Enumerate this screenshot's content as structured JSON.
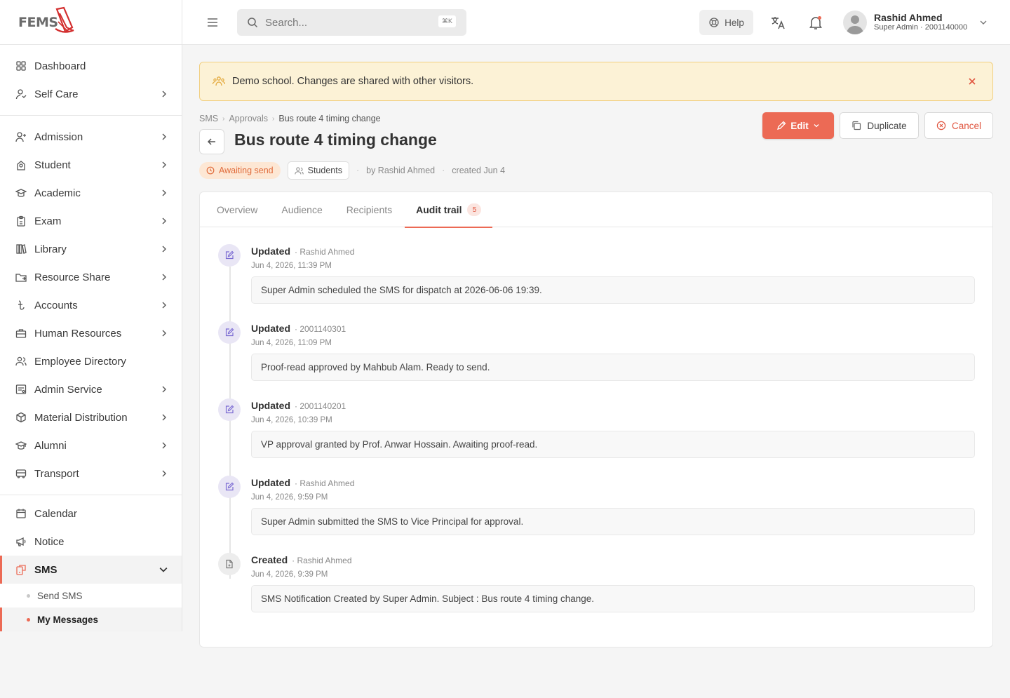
{
  "brand": {
    "logo_text": "FEMS"
  },
  "sidebar": {
    "group1": [
      {
        "label": "Dashboard",
        "icon": "grid-icon",
        "chevron": false
      },
      {
        "label": "Self Care",
        "icon": "user-care-icon",
        "chevron": true
      }
    ],
    "group2": [
      {
        "label": "Admission",
        "icon": "user-plus-icon",
        "chevron": true
      },
      {
        "label": "Student",
        "icon": "student-icon",
        "chevron": true
      },
      {
        "label": "Academic",
        "icon": "graduation-cap-icon",
        "chevron": true
      },
      {
        "label": "Exam",
        "icon": "clipboard-icon",
        "chevron": true
      },
      {
        "label": "Library",
        "icon": "books-icon",
        "chevron": true
      },
      {
        "label": "Resource Share",
        "icon": "folder-share-icon",
        "chevron": true
      },
      {
        "label": "Accounts",
        "icon": "taka-icon",
        "chevron": true
      },
      {
        "label": "Human Resources",
        "icon": "briefcase-icon",
        "chevron": true
      },
      {
        "label": "Employee Directory",
        "icon": "users-icon",
        "chevron": false
      },
      {
        "label": "Admin Service",
        "icon": "admin-service-icon",
        "chevron": true
      },
      {
        "label": "Material Distribution",
        "icon": "box-icon",
        "chevron": true
      },
      {
        "label": "Alumni",
        "icon": "alumni-cap-icon",
        "chevron": true
      },
      {
        "label": "Transport",
        "icon": "bus-icon",
        "chevron": true
      }
    ],
    "group3": [
      {
        "label": "Calendar",
        "icon": "calendar-icon"
      },
      {
        "label": "Notice",
        "icon": "megaphone-icon"
      },
      {
        "label": "SMS",
        "icon": "sms-icon"
      }
    ],
    "sms_sub": [
      {
        "label": "Send SMS"
      },
      {
        "label": "My Messages"
      }
    ]
  },
  "topbar": {
    "search_placeholder": "Search...",
    "search_shortcut": "⌘K",
    "help_label": "Help",
    "user_name": "Rashid Ahmed",
    "user_role": "Super Admin · 2001140000"
  },
  "banner": {
    "text": "Demo school. Changes are shared with other visitors."
  },
  "breadcrumb": [
    "SMS",
    "Approvals",
    "Bus route 4 timing change"
  ],
  "page": {
    "title": "Bus route 4 timing change",
    "status": "Awaiting send",
    "audience": "Students",
    "by": "by Rashid Ahmed",
    "created": "created Jun 4"
  },
  "actions": {
    "edit": "Edit",
    "duplicate": "Duplicate",
    "cancel": "Cancel"
  },
  "tabs": [
    {
      "label": "Overview"
    },
    {
      "label": "Audience"
    },
    {
      "label": "Recipients"
    },
    {
      "label": "Audit trail",
      "count": "5"
    }
  ],
  "audit": [
    {
      "action": "Updated",
      "by": "· Rashid Ahmed",
      "time": "Jun 4, 2026, 11:39 PM",
      "message": "Super Admin scheduled the SMS for dispatch at 2026-06-06 19:39."
    },
    {
      "action": "Updated",
      "by": "· 2001140301",
      "time": "Jun 4, 2026, 11:09 PM",
      "message": "Proof-read approved by Mahbub Alam. Ready to send."
    },
    {
      "action": "Updated",
      "by": "· 2001140201",
      "time": "Jun 4, 2026, 10:39 PM",
      "message": "VP approval granted by Prof. Anwar Hossain. Awaiting proof-read."
    },
    {
      "action": "Updated",
      "by": "· Rashid Ahmed",
      "time": "Jun 4, 2026, 9:59 PM",
      "message": "Super Admin submitted the SMS to Vice Principal for approval."
    },
    {
      "action": "Created",
      "by": "· Rashid Ahmed",
      "time": "Jun 4, 2026, 9:39 PM",
      "message": "SMS Notification Created by Super Admin. Subject : Bus route 4 timing change."
    }
  ],
  "colors": {
    "accent": "#ec6a55",
    "banner_bg": "#fcf2d6",
    "status_orange": "#e06c3c"
  }
}
